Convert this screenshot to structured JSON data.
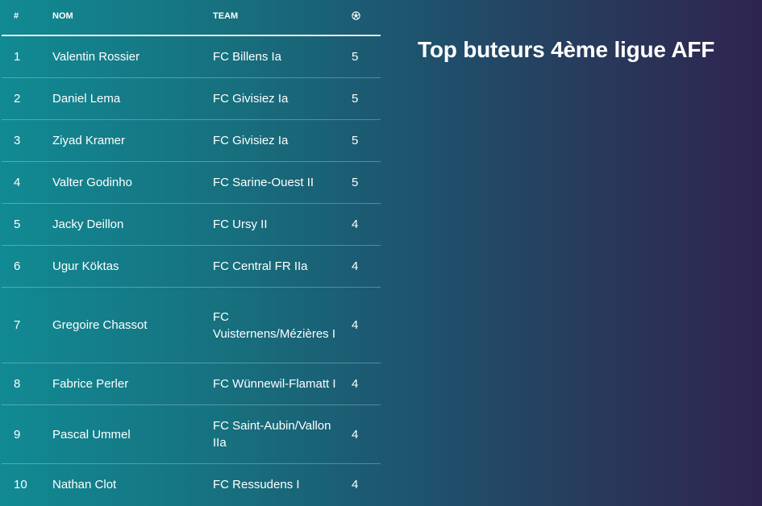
{
  "title": "Top buteurs 4ème ligue AFF",
  "table": {
    "headers": {
      "rank": "#",
      "name": "NOM",
      "team": "TEAM",
      "goals_icon": "soccer-ball-icon"
    },
    "rows": [
      {
        "rank": "1",
        "name": "Valentin Rossier",
        "team": "FC Billens Ia",
        "goals": "5"
      },
      {
        "rank": "2",
        "name": "Daniel Lema",
        "team": "FC Givisiez Ia",
        "goals": "5"
      },
      {
        "rank": "3",
        "name": "Ziyad Kramer",
        "team": "FC Givisiez Ia",
        "goals": "5"
      },
      {
        "rank": "4",
        "name": "Valter Godinho",
        "team": "FC Sarine-Ouest II",
        "goals": "5"
      },
      {
        "rank": "5",
        "name": "Jacky Deillon",
        "team": "FC Ursy II",
        "goals": "4"
      },
      {
        "rank": "6",
        "name": "Ugur Köktas",
        "team": "FC Central FR IIa",
        "goals": "4"
      },
      {
        "rank": "7",
        "name": "Gregoire Chassot",
        "team": "FC Vuisternens/Mézières I",
        "goals": "4"
      },
      {
        "rank": "8",
        "name": "Fabrice Perler",
        "team": "FC Wünnewil-Flamatt I",
        "goals": "4"
      },
      {
        "rank": "9",
        "name": "Pascal Ummel",
        "team": "FC Saint-Aubin/Vallon IIa",
        "goals": "4"
      },
      {
        "rank": "10",
        "name": "Nathan Clot",
        "team": "FC Ressudens I",
        "goals": "4"
      }
    ]
  }
}
